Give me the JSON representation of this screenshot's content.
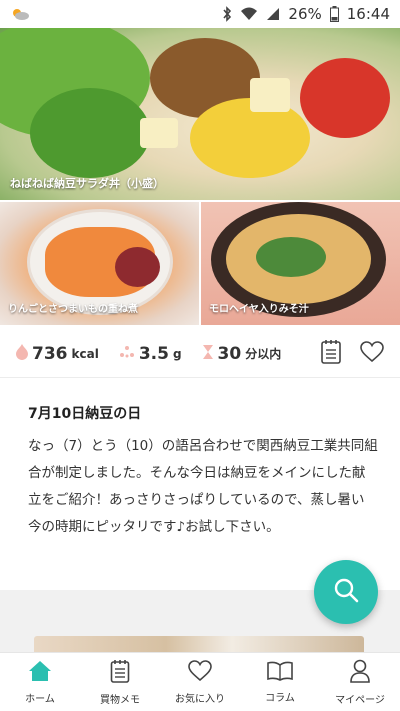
{
  "status_bar": {
    "battery": "26%",
    "time": "16:44"
  },
  "recipes": {
    "main": {
      "caption": "ねばねば納豆サラダ丼（小盛）"
    },
    "side1": {
      "caption": "りんごとさつまいもの重ね煮"
    },
    "side2": {
      "caption": "モロヘイヤ入りみそ汁"
    }
  },
  "nutrition": {
    "calories": {
      "value": "736",
      "unit": "kcal"
    },
    "salt": {
      "value": "3.5",
      "unit": "g"
    },
    "time": {
      "value": "30",
      "unit": "分以内"
    }
  },
  "article": {
    "title": "7月10日納豆の日",
    "body": "なっ（7）とう（10）の語呂合わせで関西納豆工業共同組合が制定しました。そんな今日は納豆をメインにした献立をご紹介！あっさりさっぱりしているので、蒸し暑い今の時期にピッタリです♪お試し下さい。"
  },
  "nav": {
    "home": "ホーム",
    "shopping": "買物メモ",
    "favorites": "お気に入り",
    "column": "コラム",
    "mypage": "マイページ"
  },
  "colors": {
    "accent": "#2bbfb0",
    "nutri_icon": "#f4b7b0"
  }
}
